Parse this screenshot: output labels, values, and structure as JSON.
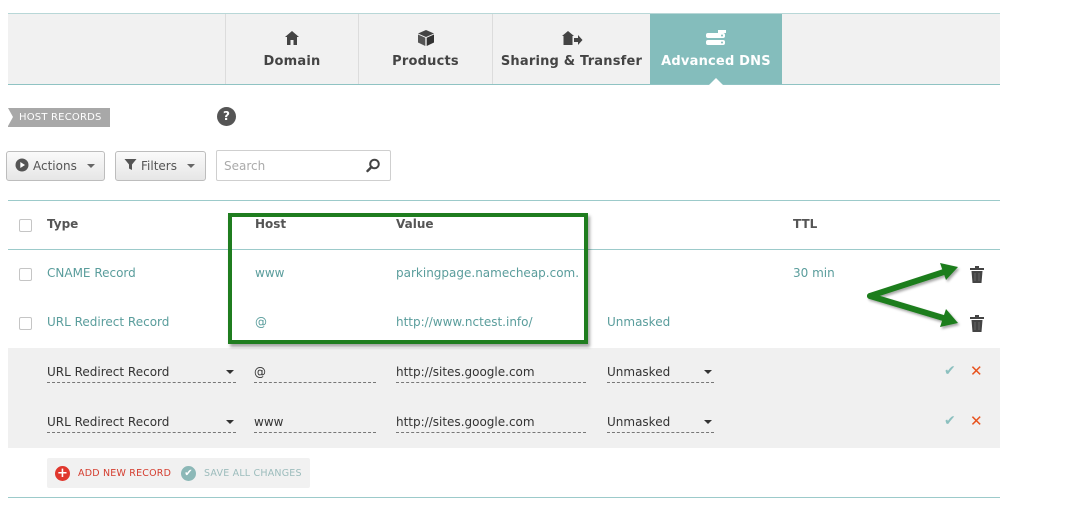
{
  "tabs": [
    {
      "label": "Domain",
      "icon": "house-icon",
      "active": false
    },
    {
      "label": "Products",
      "icon": "box-icon",
      "active": false
    },
    {
      "label": "Sharing & Transfer",
      "icon": "transfer-icon",
      "active": false
    },
    {
      "label": "Advanced DNS",
      "icon": "server-icon",
      "active": true
    }
  ],
  "section": {
    "label": "HOST RECORDS",
    "help": "?"
  },
  "toolbar": {
    "actions_label": "Actions",
    "filters_label": "Filters",
    "search_placeholder": "Search"
  },
  "table": {
    "headers": {
      "type": "Type",
      "host": "Host",
      "value": "Value",
      "ttl": "TTL"
    },
    "rows": [
      {
        "type": "CNAME Record",
        "host": "www",
        "value": "parkingpage.namecheap.com.",
        "extra": "",
        "ttl": "30 min"
      },
      {
        "type": "URL Redirect Record",
        "host": "@",
        "value": "http://www.nctest.info/",
        "extra": "Unmasked",
        "ttl": ""
      }
    ],
    "edit_rows": [
      {
        "type": "URL Redirect Record",
        "host": "@",
        "value": "http://sites.google.com",
        "mode": "Unmasked"
      },
      {
        "type": "URL Redirect Record",
        "host": "www",
        "value": "http://sites.google.com",
        "mode": "Unmasked"
      }
    ]
  },
  "footer": {
    "add_label": "ADD NEW RECORD",
    "save_label": "SAVE ALL CHANGES"
  },
  "colors": {
    "accent": "#84bdbc",
    "link": "#5a9d9c",
    "annotation": "#1f7d1f",
    "delete": "#e8531e"
  }
}
